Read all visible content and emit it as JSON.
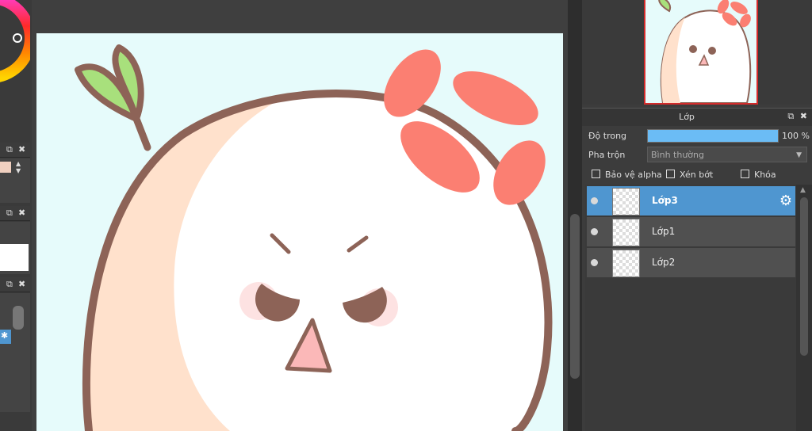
{
  "layer_panel": {
    "title": "Lớp",
    "opacity_label": "Độ trong",
    "opacity_value": "100 %",
    "opacity_fraction": 1.0,
    "blend_label": "Pha trộn",
    "blend_value": "Bình thường",
    "protect_alpha_label": "Bảo vệ alpha",
    "clip_label": "Xén bớt",
    "lock_label": "Khóa",
    "layers": [
      {
        "name": "Lớp3",
        "selected": true
      },
      {
        "name": "Lớp1",
        "selected": false
      },
      {
        "name": "Lớp2",
        "selected": false
      }
    ]
  },
  "colors": {
    "accent_selected": "#4f96d0",
    "opacity_fill": "#6bbcf5",
    "canvas_bg": "#e6fbfb",
    "outline": "#8d6357",
    "cheek_peach": "#ffe1cc",
    "anger_red": "#fb7f72",
    "leaf_green": "#a8e07c",
    "nose_pink": "#fbb8b8"
  },
  "icons": {
    "popout": "popout-icon",
    "close": "close-icon",
    "gear": "gear-icon",
    "eye": "visibility-icon"
  }
}
